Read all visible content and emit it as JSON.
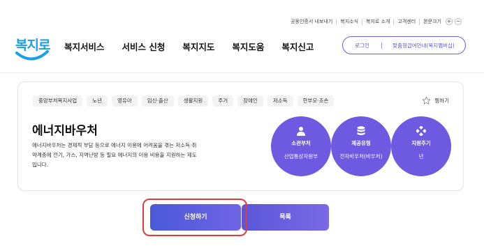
{
  "utility": {
    "items": [
      "공동인증서 내보내기",
      "복지소식",
      "복지로 소개",
      "고객센터",
      "본문크기"
    ],
    "zoom_in": "+",
    "zoom_out": "−"
  },
  "header": {
    "logo_text": "복지로",
    "nav": [
      "복지서비스",
      "서비스 신청",
      "복지지도",
      "복지도움",
      "복지신고"
    ],
    "login_label": "로그인",
    "guide_label": "맞춤형급여안내(복지멤버십)"
  },
  "service": {
    "tags": [
      "중앙부처복지사업",
      "노년",
      "영유아",
      "임신·출산",
      "생활지원",
      "주거",
      "장애인",
      "저소득",
      "한부모·조손"
    ],
    "share_label": "찜하기",
    "title": "에너지바우처",
    "description": "에너지바우처는 경제적 부담 등으로 에너지 이용에 어려움을 겪는 저소득·취약계층에 전기, 가스, 지역난방 등 필요 에너지의 이용 비용을 지원하는 제도입니다.",
    "info": [
      {
        "label": "소관부처",
        "value": "산업통상자원부",
        "icon": "person-icon"
      },
      {
        "label": "제공유형",
        "value": "전자바우처(바우처)",
        "icon": "database-icon"
      },
      {
        "label": "지원주기",
        "value": "년",
        "icon": "cycle-icon"
      }
    ]
  },
  "actions": {
    "apply_label": "신청하기",
    "list_label": "목록"
  },
  "colors": {
    "accent": "#6d5ae0",
    "logo": "#1aa0e6",
    "highlight": "#e23b3b"
  }
}
